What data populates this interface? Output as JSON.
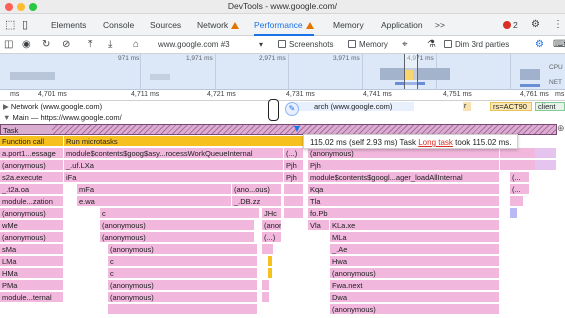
{
  "window": {
    "title": "DevTools - www.google.com/"
  },
  "tabs": {
    "elements": "Elements",
    "console": "Console",
    "sources": "Sources",
    "network": "Network",
    "performance": "Performance",
    "memory": "Memory",
    "application": "Application",
    "more": ">>",
    "error_count": "2"
  },
  "toolbar": {
    "recording": "www.google.com #3",
    "screenshots": "Screenshots",
    "memory": "Memory",
    "dim": "Dim 3rd parties"
  },
  "overview": {
    "ticks": [
      "971 ms",
      "1,971 ms",
      "2,971 ms",
      "3,971 ms",
      "4,971 ms"
    ],
    "lanes": [
      "CPU",
      "NET"
    ]
  },
  "ruler": {
    "ticks": [
      "4,701 ms",
      "4,711 ms",
      "4,721 ms",
      "4,731 ms",
      "4,741 ms",
      "4,751 ms",
      "4,761 ms"
    ],
    "ticks_right": [
      "ms",
      "ms"
    ]
  },
  "tracks": {
    "network": "Network (www.google.com)",
    "network_search": "arch (www.google.com)",
    "network_rs": "rs=ACT90",
    "network_client": "client_",
    "network_r": "r",
    "main": "Main — https://www.google.com/"
  },
  "flame": {
    "task": "Task",
    "function_call": "Function call",
    "run_microtasks": "Run microtasks",
    "col1": [
      "a.port1...essage",
      "(anonymous)",
      "s2a.execute",
      "_.t2a.oa",
      "module...zation",
      "(anonymous)",
      "wMe",
      "(anonymous)",
      "sMa",
      "LMa",
      "HMa",
      "PMa",
      "module...ternal"
    ],
    "col2": [
      "module$contents$goog$asy...rocessWorkQueueInternal",
      "_.uf.LXa",
      "iFa",
      "mFa",
      "e.wa",
      "c",
      "(anonymous)",
      "(anonymous)",
      "(anonymous)",
      "c",
      "c",
      "(anonymous)",
      "(anonymous)"
    ],
    "col3": [
      "(...)",
      "(anonymous)",
      "(anonymous)",
      "(ano...ous)",
      "_.DB.zz",
      "JHc",
      "(anonymous)",
      "(...)",
      "_.Ae"
    ],
    "col3b": [
      "Pjh",
      "Pjh"
    ],
    "col4": [
      "(anonymous)",
      "Pjh",
      "module$contents$googl...ager_loadAllInternal",
      "Kqa",
      "Tla",
      "fo.Pb",
      "Vla",
      "KLa.xe",
      "MLa",
      "_.Ae",
      "Hwa",
      "(anonymous)",
      "Fwa.next",
      "Dwa",
      "(anonymous)"
    ],
    "col5": [
      "(...",
      "(...",
      "(anonymous)"
    ]
  },
  "tooltip": {
    "duration": "115.02 ms (self 2.93 ms)",
    "task": "Task",
    "long_task": "Long task",
    "took": "took 115.02 ms."
  }
}
